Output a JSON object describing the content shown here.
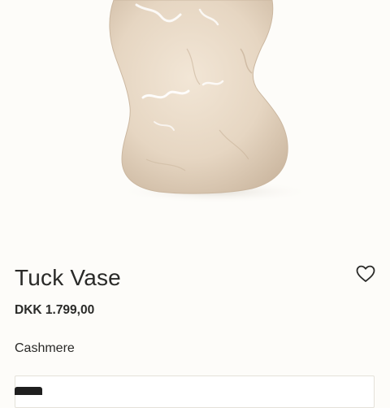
{
  "product": {
    "name": "Tuck Vase",
    "price": "DKK 1.799,00",
    "variant_label": "Cashmere",
    "image_icon": "vase-product-image"
  },
  "actions": {
    "wishlist_icon": "heart-icon"
  },
  "colors": {
    "background": "#fdfcf9",
    "vase": "#e6d6c2",
    "text": "#2a2a28"
  }
}
